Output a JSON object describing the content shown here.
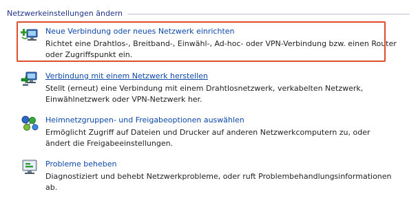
{
  "section": {
    "title": "Netzwerkeinstellungen ändern"
  },
  "tasks": [
    {
      "icon": "new-connection-icon",
      "link": "Neue Verbindung oder neues Netzwerk einrichten",
      "description": "Richtet eine Drahtlos-, Breitband-, Einwähl-, Ad-hoc- oder VPN-Verbindung bzw. einen Router oder Zugriffspunkt ein."
    },
    {
      "icon": "connect-to-network-icon",
      "link": "Verbindung mit einem Netzwerk herstellen",
      "description": "Stellt (erneut) eine Verbindung mit einem Drahtlosnetzwerk, verkabelten Netzwerk, Einwählnetzwerk oder VPN-Netzwerk her."
    },
    {
      "icon": "homegroup-sharing-icon",
      "link": "Heimnetzgruppen- und Freigabeoptionen auswählen",
      "description": "Ermöglicht Zugriff auf Dateien und Drucker auf anderen Netzwerkcomputern zu, oder ändert die Freigabeeinstellungen."
    },
    {
      "icon": "troubleshoot-icon",
      "link": "Probleme beheben",
      "description": "Diagnostiziert und behebt Netzwerkprobleme, oder ruft Problembehandlungsinformationen ab."
    }
  ],
  "colors": {
    "link": "#0b47a8",
    "highlight": "#e04b2a",
    "section_title": "#1e3287"
  }
}
